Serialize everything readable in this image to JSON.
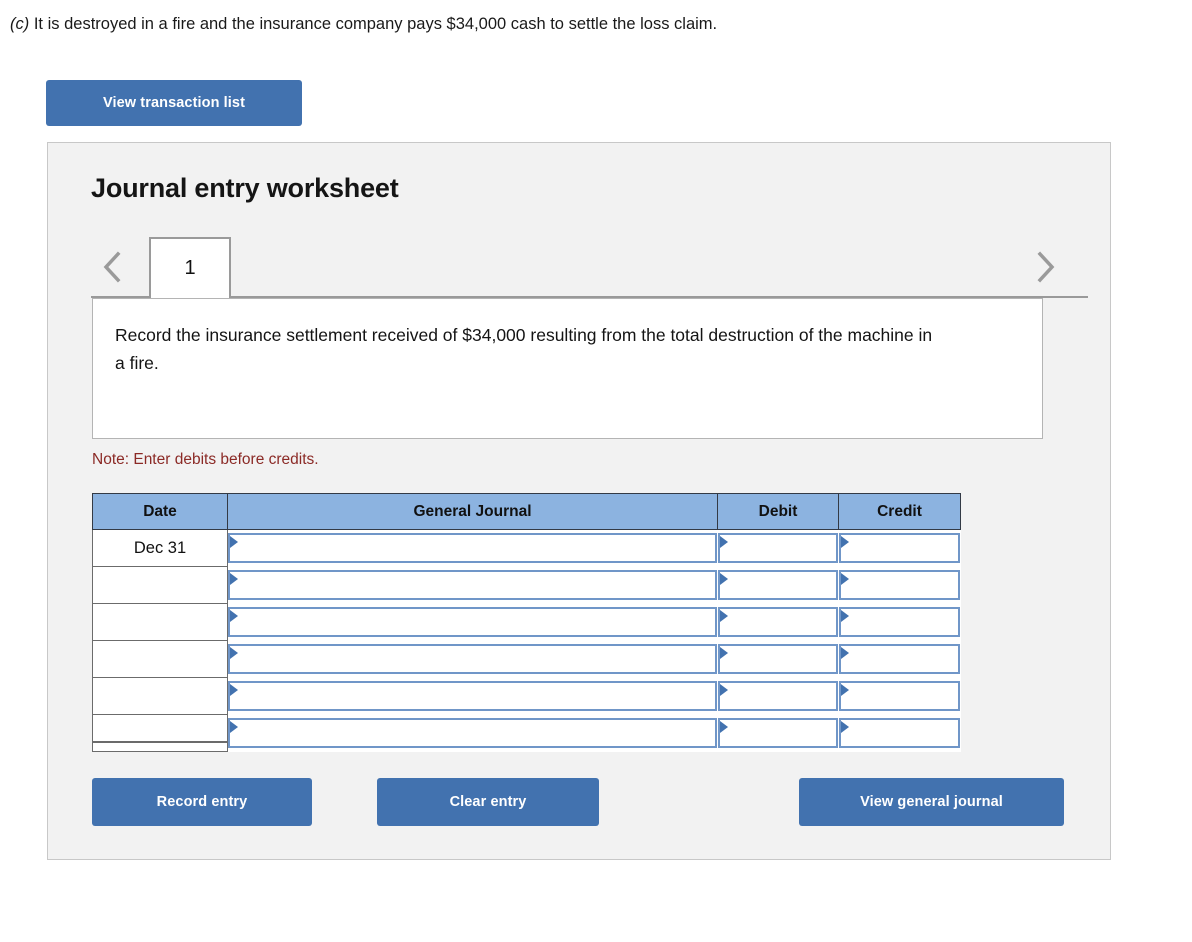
{
  "question": {
    "letter": "(c)",
    "text": " It is destroyed in a fire and the insurance company pays $34,000 cash to settle the loss claim."
  },
  "toolbar": {
    "view_transaction_list_label": "View transaction list"
  },
  "worksheet": {
    "title": "Journal entry worksheet",
    "tabs": [
      {
        "label": "1",
        "selected": true
      }
    ],
    "prev_label": "‹",
    "next_label": "›",
    "description": "Record the insurance settlement received of $34,000 resulting from the total destruction of the machine in a fire.",
    "note": "Note: Enter debits before credits."
  },
  "table": {
    "headers": [
      "Date",
      "General Journal",
      "Debit",
      "Credit"
    ],
    "rows": [
      {
        "date": "Dec 31",
        "general_journal": "",
        "debit": "",
        "credit": ""
      },
      {
        "date": "",
        "general_journal": "",
        "debit": "",
        "credit": ""
      },
      {
        "date": "",
        "general_journal": "",
        "debit": "",
        "credit": ""
      },
      {
        "date": "",
        "general_journal": "",
        "debit": "",
        "credit": ""
      },
      {
        "date": "",
        "general_journal": "",
        "debit": "",
        "credit": ""
      },
      {
        "date": "",
        "general_journal": "",
        "debit": "",
        "credit": ""
      }
    ]
  },
  "footer": {
    "record_entry_label": "Record entry",
    "clear_entry_label": "Clear entry",
    "view_general_journal_label": "View general journal"
  },
  "colors": {
    "button_blue": "#4272af",
    "table_header_blue": "#8cb3e0",
    "cell_border_blue": "#7096c8",
    "note_red": "#8b2a26",
    "panel_gray": "#f2f2f2"
  }
}
